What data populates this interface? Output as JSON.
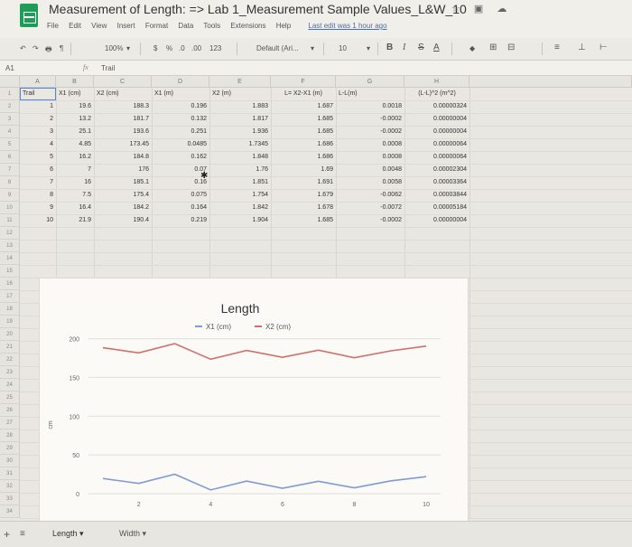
{
  "header": {
    "title": "Measurement of Length: => Lab 1_Measurement Sample Values_L&W_10",
    "title_icons": "☆ ▣ ☁",
    "menu": [
      "File",
      "Edit",
      "View",
      "Insert",
      "Format",
      "Data",
      "Tools",
      "Extensions",
      "Help"
    ],
    "last_edit": "Last edit was 1 hour ago"
  },
  "toolbar": {
    "undo": "↶",
    "redo": "↷",
    "print": "🖶",
    "paint": "¶",
    "zoom": "100%",
    "zoom_caret": "▾",
    "currency": "$",
    "percent": "%",
    "dec_less": ".0",
    "dec_more": ".00",
    "format_123": "123",
    "font": "Default (Ari...",
    "font_caret": "▾",
    "font_size": "10",
    "size_caret": "▾",
    "bold": "B",
    "italic": "I",
    "strike": "S",
    "text_color": "A",
    "fill": "◆",
    "borders": "⊞",
    "merge": "⊟",
    "align": "≡",
    "valign": "⊥",
    "wrap": "⊢"
  },
  "formula_bar": {
    "cell_ref": "A1",
    "fx": "fx",
    "content": "Trail"
  },
  "columns": [
    "A",
    "B",
    "C",
    "D",
    "E",
    "F",
    "G",
    "H"
  ],
  "row_numbers": [
    "1",
    "2",
    "3",
    "4",
    "5",
    "6",
    "7",
    "8",
    "9",
    "10",
    "11",
    "12",
    "13",
    "14",
    "15",
    "16",
    "17",
    "18",
    "19",
    "20",
    "21",
    "22",
    "23",
    "24",
    "25",
    "26",
    "27",
    "28",
    "29",
    "30",
    "31",
    "32",
    "33",
    "34"
  ],
  "table": {
    "headers": [
      "Trail",
      "X1 (cm)",
      "X2 (cm)",
      "X1 (m)",
      "X2 (m)",
      "L= X2-X1 (m)",
      "L-L(m)",
      "(L-L)^2 (m^2)"
    ],
    "rows": [
      [
        "1",
        "19.6",
        "188.3",
        "0.196",
        "1.883",
        "1.687",
        "0.0018",
        "0.00000324"
      ],
      [
        "2",
        "13.2",
        "181.7",
        "0.132",
        "1.817",
        "1.685",
        "-0.0002",
        "0.00000004"
      ],
      [
        "3",
        "25.1",
        "193.6",
        "0.251",
        "1.936",
        "1.685",
        "-0.0002",
        "0.00000004"
      ],
      [
        "4",
        "4.85",
        "173.45",
        "0.0485",
        "1.7345",
        "1.686",
        "0.0008",
        "0.00000064"
      ],
      [
        "5",
        "16.2",
        "184.8",
        "0.162",
        "1.848",
        "1.686",
        "0.0008",
        "0.00000064"
      ],
      [
        "6",
        "7",
        "176",
        "0.07",
        "1.76",
        "1.69",
        "0.0048",
        "0.00002304"
      ],
      [
        "7",
        "16",
        "185.1",
        "0.16",
        "1.851",
        "1.691",
        "0.0058",
        "0.00003364"
      ],
      [
        "8",
        "7.5",
        "175.4",
        "0.075",
        "1.754",
        "1.679",
        "-0.0062",
        "0.00003844"
      ],
      [
        "9",
        "16.4",
        "184.2",
        "0.164",
        "1.842",
        "1.678",
        "-0.0072",
        "0.00005184"
      ],
      [
        "10",
        "21.9",
        "190.4",
        "0.219",
        "1.904",
        "1.685",
        "-0.0002",
        "0.00000004"
      ]
    ]
  },
  "chart_data": {
    "type": "line",
    "title": "Length",
    "xlabel": "",
    "ylabel": "cm",
    "x": [
      1,
      2,
      3,
      4,
      5,
      6,
      7,
      8,
      9,
      10
    ],
    "x_ticks": [
      "2",
      "4",
      "6",
      "8",
      "10"
    ],
    "y_ticks": [
      "0",
      "50",
      "100",
      "150",
      "200"
    ],
    "ylim": [
      0,
      210
    ],
    "grid": true,
    "legend": "top",
    "series": [
      {
        "name": "X1 (cm)",
        "color": "#7f9bd6",
        "values": [
          19.6,
          13.2,
          25.1,
          4.85,
          16.2,
          7,
          16,
          7.5,
          16.4,
          21.9
        ]
      },
      {
        "name": "X2 (cm)",
        "color": "#d26f6a",
        "values": [
          188.3,
          181.7,
          193.6,
          173.45,
          184.8,
          176,
          185.1,
          175.4,
          184.2,
          190.4
        ]
      }
    ]
  },
  "sheet_tabs": {
    "add": "+",
    "list": "≡",
    "active": "Length",
    "other": "Width",
    "caret": "▾"
  },
  "misc": {
    "cursor": "✱"
  }
}
